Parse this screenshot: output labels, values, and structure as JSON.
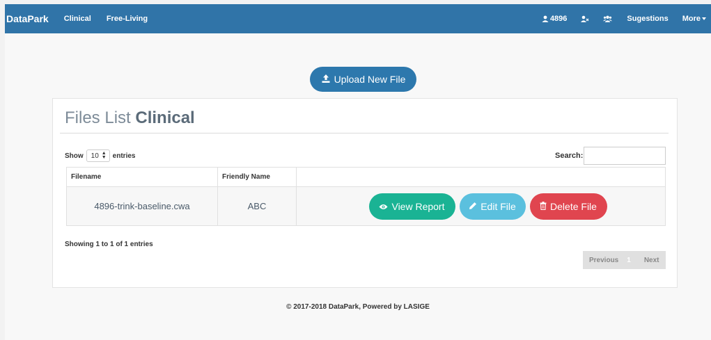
{
  "navbar": {
    "brand": "DataPark",
    "links": [
      "Clinical",
      "Free-Living"
    ],
    "user_count": "4896",
    "suggestions_label": "Sugestions",
    "more_label": "More",
    "color": "#3074a8"
  },
  "upload": {
    "label": "Upload New File",
    "icon": "upload-icon",
    "color": "#2d78ad"
  },
  "panel": {
    "title_prefix": "Files List",
    "title_bold": "Clinical",
    "show_label": "Show",
    "page_length": "10",
    "entries_label": "entries",
    "search_label": "Search:",
    "search_value": ""
  },
  "table": {
    "headers": [
      "Filename",
      "Friendly Name",
      ""
    ],
    "rows": [
      {
        "filename": "4896-trink-baseline.cwa",
        "friendly_name": "ABC",
        "actions": {
          "view": {
            "label": "View Report",
            "icon": "eye-icon",
            "color": "#1ab394"
          },
          "edit": {
            "label": "Edit File",
            "icon": "pencil-icon",
            "color": "#5bc0de"
          },
          "delete": {
            "label": "Delete File",
            "icon": "trash-icon",
            "color": "#e0454f"
          }
        }
      }
    ]
  },
  "table_info": "Showing 1 to 1 of 1 entries",
  "pagination": {
    "previous": "Previous",
    "current_page": "1",
    "next": "Next"
  },
  "footer": {
    "text": "© 2017-2018 DataPark, Powered by LASIGE"
  }
}
